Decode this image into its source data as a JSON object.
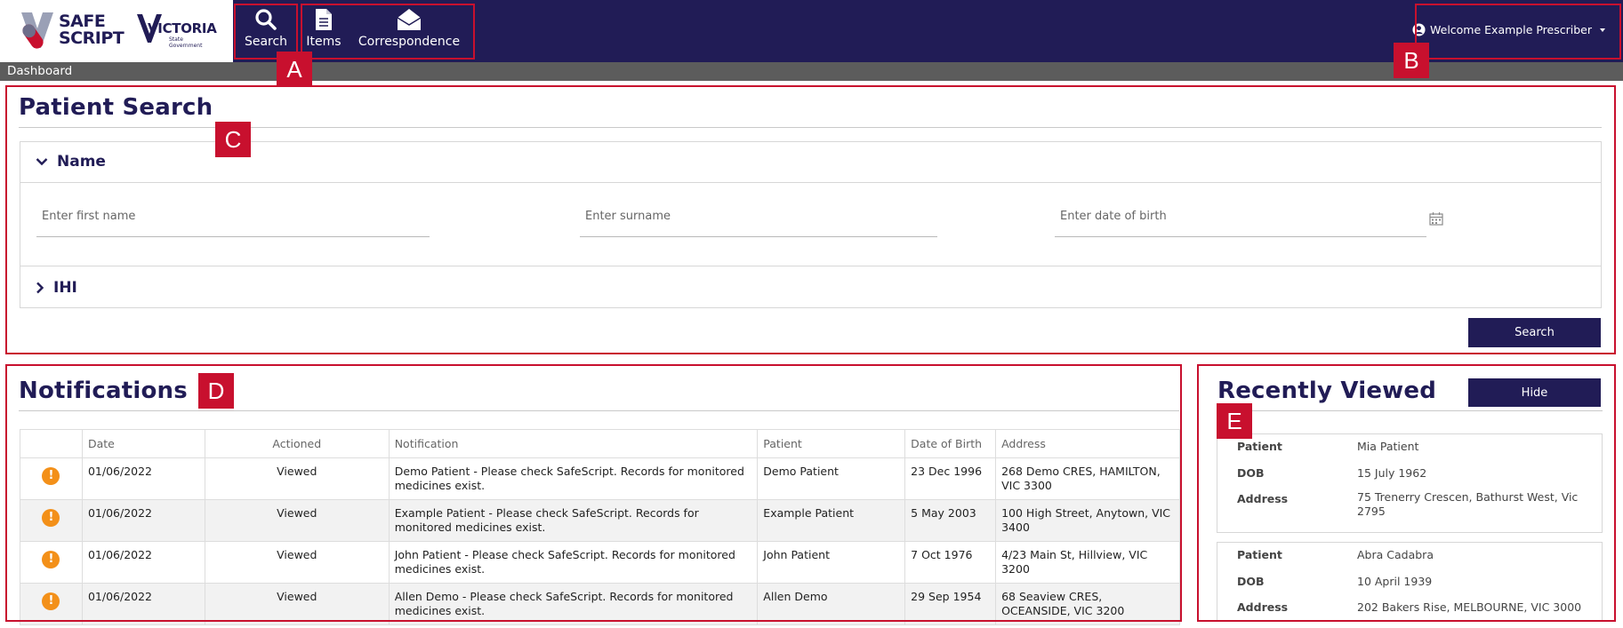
{
  "brand": {
    "safescript_line1": "SAFE",
    "safescript_line2": "SCRIPT",
    "victoria_title": "VICTORIA",
    "victoria_sub1": "State",
    "victoria_sub2": "Government"
  },
  "nav": {
    "search_label": "Search",
    "items_label": "Items",
    "correspondence_label": "Correspondence"
  },
  "user": {
    "welcome_label": "Welcome Example Prescriber"
  },
  "breadcrumb": {
    "label": "Dashboard"
  },
  "annotations": {
    "a": "A",
    "b": "B",
    "c": "C",
    "d": "D",
    "e": "E"
  },
  "patient_search": {
    "title": "Patient Search",
    "name_section": "Name",
    "ihi_section": "IHI",
    "first_name_placeholder": "Enter first name",
    "surname_placeholder": "Enter surname",
    "dob_placeholder": "Enter date of birth",
    "search_button": "Search"
  },
  "notifications": {
    "title": "Notifications",
    "columns": [
      "",
      "Date",
      "Actioned",
      "Notification",
      "Patient",
      "Date of Birth",
      "Address"
    ],
    "rows": [
      {
        "date": "01/06/2022",
        "actioned": "Viewed",
        "notification": "Demo Patient - Please check SafeScript. Records for monitored medicines exist.",
        "patient": "Demo Patient",
        "dob": "23 Dec 1996",
        "address": "268 Demo CRES, HAMILTON, VIC 3300"
      },
      {
        "date": "01/06/2022",
        "actioned": "Viewed",
        "notification": "Example Patient - Please check SafeScript. Records for monitored medicines exist.",
        "patient": "Example Patient",
        "dob": "5 May 2003",
        "address": "100 High Street, Anytown, VIC 3400"
      },
      {
        "date": "01/06/2022",
        "actioned": "Viewed",
        "notification": "John Patient - Please check SafeScript. Records for monitored medicines exist.",
        "patient": "John Patient",
        "dob": "7 Oct 1976",
        "address": "4/23 Main St, Hillview, VIC 3200"
      },
      {
        "date": "01/06/2022",
        "actioned": "Viewed",
        "notification": "Allen Demo - Please check SafeScript. Records for monitored medicines exist.",
        "patient": "Allen Demo",
        "dob": "29 Sep 1954",
        "address": "68 Seaview CRES, OCEANSIDE, VIC 3200"
      }
    ]
  },
  "recently_viewed": {
    "title": "Recently Viewed",
    "hide_button": "Hide",
    "labels": {
      "patient": "Patient",
      "dob": "DOB",
      "address": "Address"
    },
    "cards": [
      {
        "patient": "Mia Patient",
        "dob": "15 July 1962",
        "address": "75 Trenerry Crescen, Bathurst West, Vic 2795"
      },
      {
        "patient": "Abra Cadabra",
        "dob": "10 April 1939",
        "address": "202 Bakers Rise, MELBOURNE, VIC 3000"
      }
    ]
  },
  "colors": {
    "navy": "#211c56",
    "annotation_red": "#c8102e",
    "warning_orange": "#f39019",
    "subbar_grey": "#5c5c5c"
  },
  "icons": [
    "search-icon",
    "document-icon",
    "envelope-icon",
    "user-circle-icon",
    "chevron-down-icon",
    "chevron-right-icon",
    "calendar-icon",
    "warning-icon"
  ]
}
